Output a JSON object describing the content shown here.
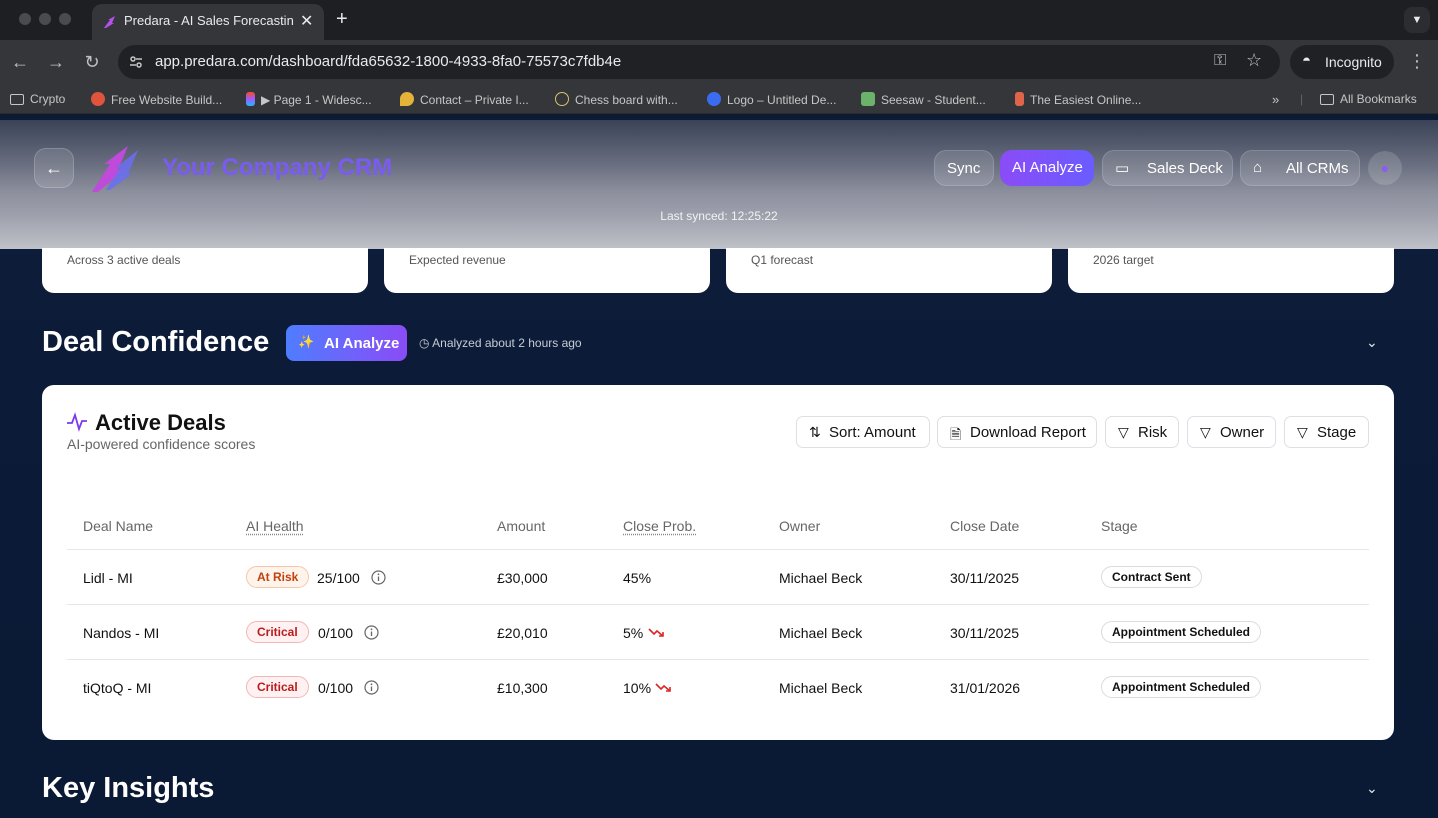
{
  "browser": {
    "tab_title": "Predara - AI Sales Forecasting",
    "url": "app.predara.com/dashboard/fda65632-1800-4933-8fa0-75573c7fdb4e",
    "incognito_label": "Incognito",
    "bookmarks": [
      {
        "label": "Crypto",
        "icon": "folder-icon"
      },
      {
        "label": "Free Website Build...",
        "icon": "site-icon"
      },
      {
        "label": "▶ Page 1 - Widesc...",
        "icon": "figma-icon"
      },
      {
        "label": "Contact – Private I...",
        "icon": "drop-icon"
      },
      {
        "label": "Chess board with...",
        "icon": "bulb-icon"
      },
      {
        "label": "Logo – Untitled De...",
        "icon": "canva-icon"
      },
      {
        "label": "Seesaw - Student...",
        "icon": "image-icon"
      },
      {
        "label": "The Easiest Online...",
        "icon": "brush-icon"
      }
    ],
    "all_bookmarks_label": "All Bookmarks"
  },
  "header": {
    "company": "Your Company CRM",
    "buttons": {
      "sync": "Sync",
      "ai_analyze": "AI Analyze",
      "sales_deck": "Sales Deck",
      "all_crms": "All CRMs"
    },
    "last_synced": "Last synced: 12:25:22"
  },
  "kpis": [
    {
      "sub": "Across 3 active deals"
    },
    {
      "sub": "Expected revenue"
    },
    {
      "sub": "Q1 forecast"
    },
    {
      "sub": "2026 target"
    }
  ],
  "deal_confidence": {
    "title": "Deal Confidence",
    "ai_button": "AI Analyze",
    "analyzed": "Analyzed about 2 hours ago"
  },
  "deals_card": {
    "title": "Active Deals",
    "subtitle": "AI-powered confidence scores",
    "actions": {
      "sort": "Sort: Amount",
      "download": "Download Report",
      "risk": "Risk",
      "owner": "Owner",
      "stage": "Stage"
    },
    "columns": [
      "Deal Name",
      "AI Health",
      "Amount",
      "Close Prob.",
      "Owner",
      "Close Date",
      "Stage"
    ],
    "rows": [
      {
        "name": "Lidl - MI",
        "health_label": "At Risk",
        "health_kind": "risk",
        "score": "25/100",
        "amount": "£30,000",
        "prob": "45%",
        "trend": "",
        "owner": "Michael Beck",
        "close_date": "30/11/2025",
        "stage": "Contract Sent"
      },
      {
        "name": "Nandos - MI",
        "health_label": "Critical",
        "health_kind": "crit",
        "score": "0/100",
        "amount": "£20,010",
        "prob": "5%",
        "trend": "down",
        "owner": "Michael Beck",
        "close_date": "30/11/2025",
        "stage": "Appointment Scheduled"
      },
      {
        "name": "tiQtoQ - MI",
        "health_label": "Critical",
        "health_kind": "crit",
        "score": "0/100",
        "amount": "£10,300",
        "prob": "10%",
        "trend": "down",
        "owner": "Michael Beck",
        "close_date": "31/01/2026",
        "stage": "Appointment Scheduled"
      }
    ]
  },
  "key_insights": {
    "title": "Key Insights"
  }
}
